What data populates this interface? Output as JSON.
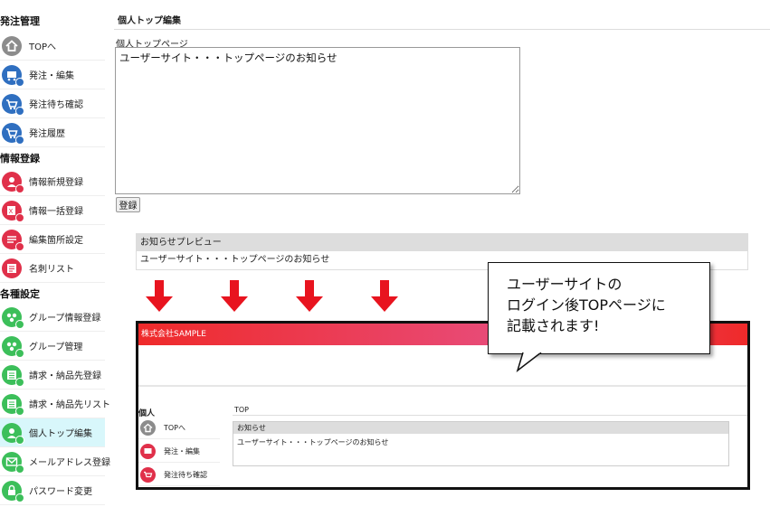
{
  "sidebar": {
    "sections": [
      {
        "title": "発注管理",
        "items": [
          {
            "label": "TOPへ",
            "icon": "home-icon",
            "color": "#8c8c8c",
            "badge": ""
          },
          {
            "label": "発注・編集",
            "icon": "order-edit-icon",
            "color": "#2f6fc0",
            "badge": "#2f6fc0"
          },
          {
            "label": "発注待ち確認",
            "icon": "cart-pending-icon",
            "color": "#2f6fc0",
            "badge": "#2f6fc0"
          },
          {
            "label": "発注履歴",
            "icon": "cart-history-icon",
            "color": "#2f6fc0",
            "badge": "#2f6fc0"
          }
        ]
      },
      {
        "title": "情報登録",
        "items": [
          {
            "label": "情報新規登録",
            "icon": "user-add-icon",
            "color": "#e0304a",
            "badge": "#e0304a"
          },
          {
            "label": "情報一括登録",
            "icon": "excel-import-icon",
            "color": "#e0304a",
            "badge": "#e0304a"
          },
          {
            "label": "編集箇所設定",
            "icon": "list-settings-icon",
            "color": "#e0304a",
            "badge": "#e0304a"
          },
          {
            "label": "名刺リスト",
            "icon": "card-list-icon",
            "color": "#e0304a",
            "badge": ""
          }
        ]
      },
      {
        "title": "各種設定",
        "items": [
          {
            "label": "グループ情報登録",
            "icon": "group-add-icon",
            "color": "#3cbf5a",
            "badge": "#3cbf5a"
          },
          {
            "label": "グループ管理",
            "icon": "group-manage-icon",
            "color": "#3cbf5a",
            "badge": "#3cbf5a"
          },
          {
            "label": "請求・納品先登録",
            "icon": "billing-add-icon",
            "color": "#3cbf5a",
            "badge": "#3cbf5a"
          },
          {
            "label": "請求・納品先リスト",
            "icon": "billing-list-icon",
            "color": "#3cbf5a",
            "badge": "#3cbf5a"
          },
          {
            "label": "個人トップ編集",
            "icon": "user-edit-icon",
            "color": "#3cbf5a",
            "badge": "#3cbf5a",
            "active": true
          },
          {
            "label": "メールアドレス登録",
            "icon": "mail-icon",
            "color": "#3cbf5a",
            "badge": "#3cbf5a"
          },
          {
            "label": "パスワード変更",
            "icon": "lock-icon",
            "color": "#3cbf5a",
            "badge": "#3cbf5a"
          }
        ]
      }
    ]
  },
  "main": {
    "title": "個人トップ編集",
    "field_label": "個人トップページ",
    "textarea_value": "ユーザーサイト・・・トップページのお知らせ",
    "register_label": "登録",
    "preview": {
      "title": "お知らせプレビュー",
      "body": "ユーザーサイト・・・トップページのお知らせ"
    }
  },
  "mock_site": {
    "company": "株式会社SAMPLE",
    "section": "個人",
    "page_title": "TOP",
    "items": [
      {
        "label": "TOPへ",
        "icon": "home-icon",
        "color": "#8c8c8c"
      },
      {
        "label": "発注・編集",
        "icon": "order-edit-icon",
        "color": "#e0304a"
      },
      {
        "label": "発注待ち確認",
        "icon": "cart-pending-icon",
        "color": "#e0304a"
      }
    ],
    "notice_title": "お知らせ",
    "notice_body": "ユーザーサイト・・・トップページのお知らせ"
  },
  "callout": {
    "lines": [
      "ユーザーサイトの",
      "ログイン後TOPページに",
      "記載されます!"
    ]
  },
  "colors": {
    "arrow": "#e8141f",
    "active_bg": "#d8f7fb"
  }
}
